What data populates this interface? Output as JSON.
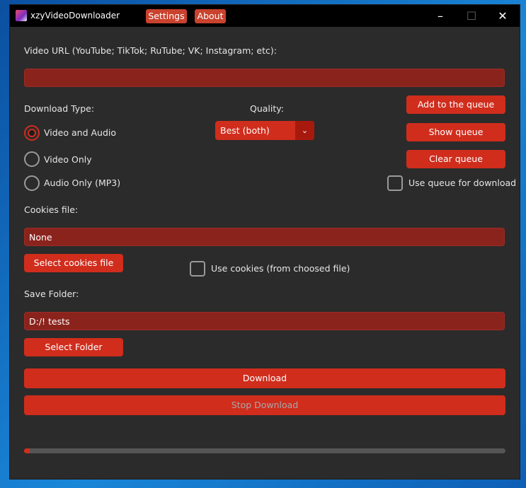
{
  "window": {
    "title": "xzyVideoDownloader",
    "menu": [
      "Settings",
      "About"
    ],
    "controls": {
      "minimize": "–",
      "maximize": "☐",
      "close": "✕"
    }
  },
  "url": {
    "label": "Video URL (YouTube; TikTok; RuTube; VK; Instagram; etc):",
    "value": ""
  },
  "download_type": {
    "label": "Download Type:",
    "options": [
      "Video and Audio",
      "Video Only",
      "Audio Only (MP3)"
    ],
    "selected": "Video and Audio"
  },
  "quality": {
    "label": "Quality:",
    "value": "Best (both)",
    "arrow": "⌄"
  },
  "queue": {
    "add": "Add to the queue",
    "show": "Show queue",
    "clear": "Clear queue",
    "use_label": "Use queue for download",
    "use_checked": false
  },
  "cookies": {
    "label": "Cookies file:",
    "value": "None",
    "select": "Select cookies file",
    "use_label": "Use cookies (from choosed file)",
    "use_checked": false
  },
  "save": {
    "label": "Save Folder:",
    "value": "D:/! tests",
    "select": "Select Folder"
  },
  "actions": {
    "download": "Download",
    "stop": "Stop Download"
  },
  "progress": {
    "fraction": 0.012
  },
  "colors": {
    "accent": "#d02d1d",
    "entry_bg": "#8b231d",
    "window_bg": "#2b2b2b",
    "titlebar_bg": "#000000"
  }
}
